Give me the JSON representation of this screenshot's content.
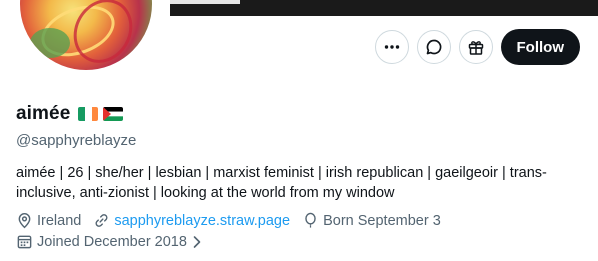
{
  "profile": {
    "display_name": "aimée",
    "flags": [
      "ireland-flag",
      "palestine-flag"
    ],
    "handle": "@sapphyreblayze",
    "bio": "aimée | 26 | she/her | lesbian | marxist feminist | irish republican | gaeilgeoir | trans-inclusive, anti-zionist | looking at the world from my window",
    "location": "Ireland",
    "website": "sapphyreblayze.straw.page",
    "birthday": "Born September 3",
    "joined": "Joined December 2018"
  },
  "actions": {
    "follow_label": "Follow",
    "icons": [
      "more-icon",
      "message-icon",
      "gift-icon"
    ]
  },
  "colors": {
    "accent_link": "#1d9bf0",
    "follow_bg": "#0f1419",
    "secondary_text": "#536471"
  }
}
